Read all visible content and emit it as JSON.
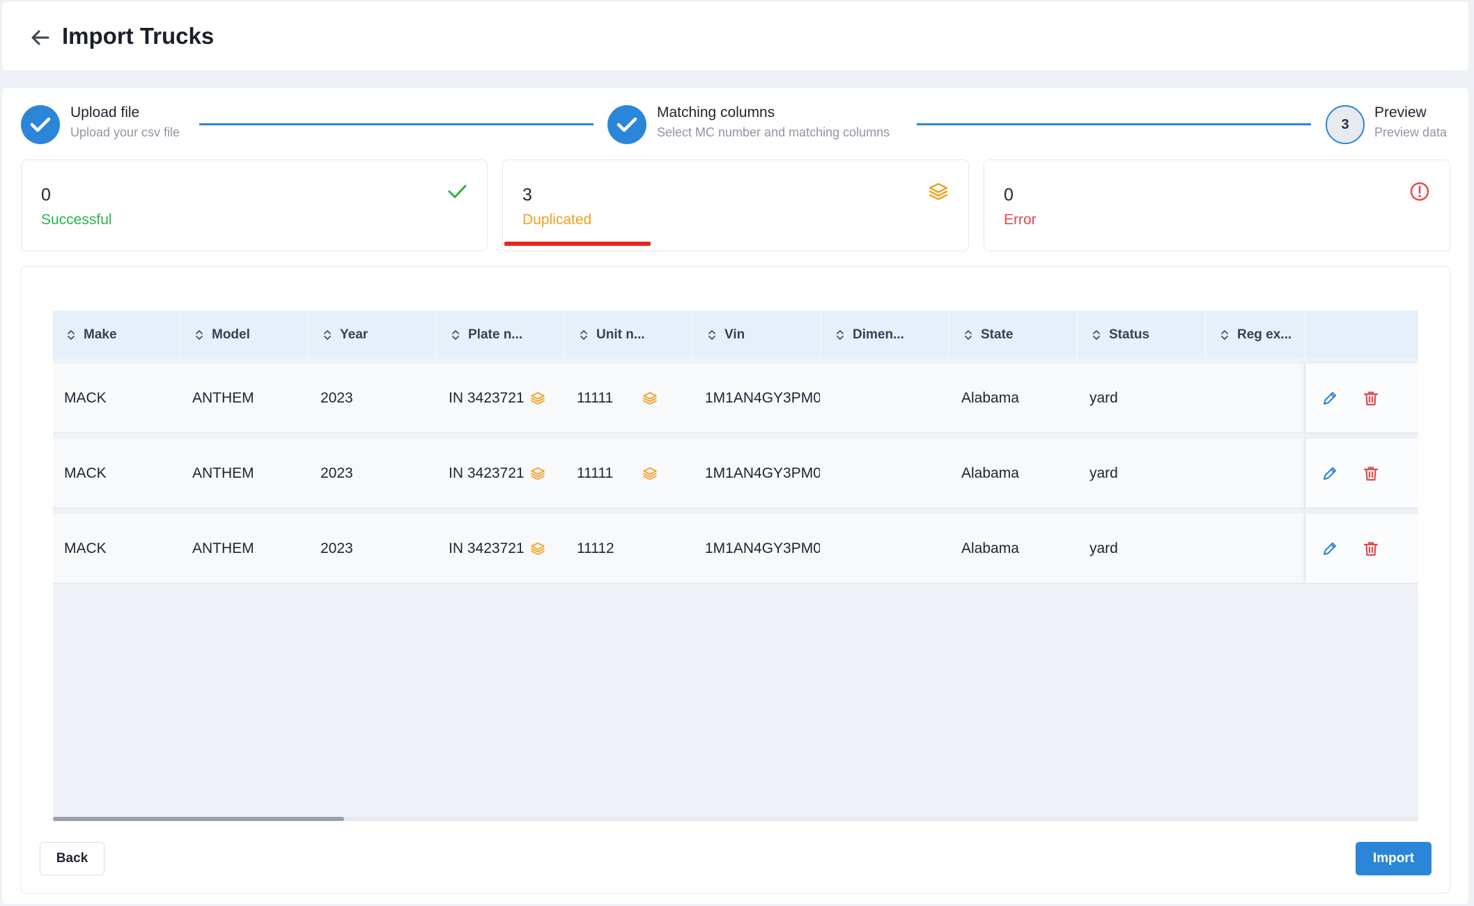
{
  "header": {
    "title": "Import Trucks"
  },
  "steps": [
    {
      "title": "Upload file",
      "subtitle": "Upload your csv file",
      "state": "done"
    },
    {
      "title": "Matching columns",
      "subtitle": "Select MC number and matching columns",
      "state": "done"
    },
    {
      "title": "Preview",
      "subtitle": "Preview data",
      "state": "current",
      "number": "3"
    }
  ],
  "stats": {
    "successful": {
      "count": "0",
      "label": "Successful",
      "color": "#2bb24c"
    },
    "duplicated": {
      "count": "3",
      "label": "Duplicated",
      "color": "#f0a122"
    },
    "error": {
      "count": "0",
      "label": "Error",
      "color": "#e5484d"
    }
  },
  "table": {
    "columns": [
      "Make",
      "Model",
      "Year",
      "Plate n...",
      "Unit n...",
      "Vin",
      "Dimen...",
      "State",
      "Status",
      "Reg ex..."
    ],
    "rows": [
      {
        "make": "MACK",
        "model": "ANTHEM",
        "year": "2023",
        "plate": "IN 3423721",
        "unit": "11111",
        "vin": "1M1AN4GY3PM0",
        "dimension": "",
        "state": "Alabama",
        "status": "yard",
        "reg": "",
        "plate_dup": true,
        "unit_dup": true
      },
      {
        "make": "MACK",
        "model": "ANTHEM",
        "year": "2023",
        "plate": "IN 3423721",
        "unit": "11111",
        "vin": "1M1AN4GY3PM0",
        "dimension": "",
        "state": "Alabama",
        "status": "yard",
        "reg": "",
        "plate_dup": true,
        "unit_dup": true
      },
      {
        "make": "MACK",
        "model": "ANTHEM",
        "year": "2023",
        "plate": "IN 3423721",
        "unit": "11112",
        "vin": "1M1AN4GY3PM0",
        "dimension": "",
        "state": "Alabama",
        "status": "yard",
        "reg": "",
        "plate_dup": true,
        "unit_dup": false
      }
    ]
  },
  "footer": {
    "back_label": "Back",
    "import_label": "Import"
  },
  "colors": {
    "accent": "#2b86d9",
    "duplicate": "#f0a122",
    "danger": "#e5484d",
    "success": "#2bb24c"
  }
}
